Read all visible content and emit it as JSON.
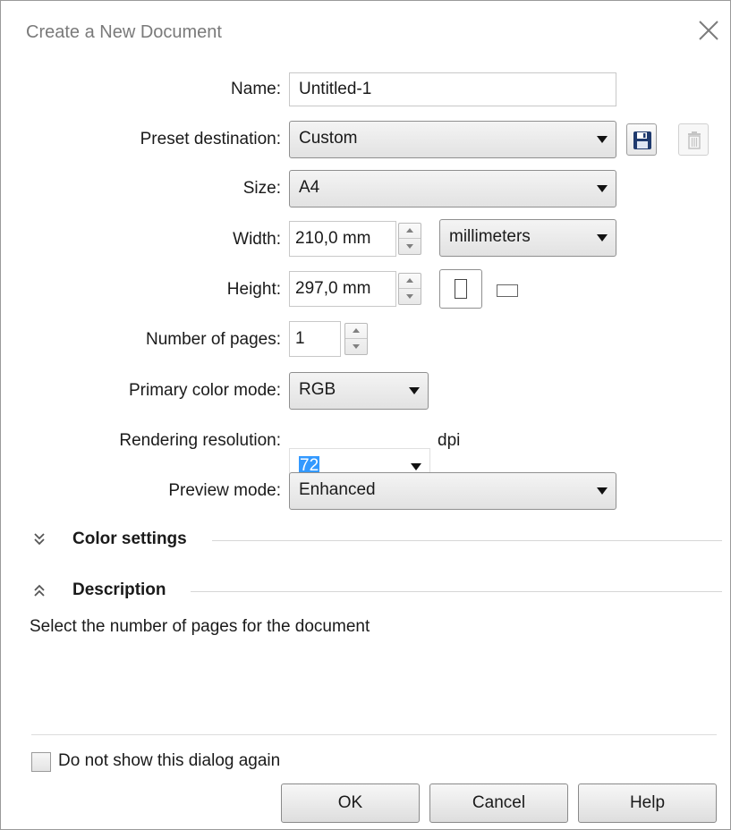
{
  "window": {
    "title": "Create a New Document",
    "close_icon": "close-icon"
  },
  "form": {
    "name": {
      "label": "Name:",
      "value": "Untitled-1"
    },
    "preset_destination": {
      "label": "Preset destination:",
      "value": "Custom",
      "save_icon": "save-icon",
      "delete_icon": "trash-icon"
    },
    "size": {
      "label": "Size:",
      "value": "A4"
    },
    "width": {
      "label": "Width:",
      "value": "210,0 mm",
      "units": "millimeters"
    },
    "height": {
      "label": "Height:",
      "value": "297,0 mm",
      "portrait_icon": "portrait-page-icon",
      "landscape_icon": "landscape-page-icon"
    },
    "pages": {
      "label": "Number of pages:",
      "value": "1"
    },
    "color_mode": {
      "label": "Primary color mode:",
      "value": "RGB"
    },
    "resolution": {
      "label": "Rendering resolution:",
      "value": "72",
      "unit": "dpi"
    },
    "preview_mode": {
      "label": "Preview mode:",
      "value": "Enhanced"
    }
  },
  "sections": {
    "color_settings": {
      "label": "Color settings",
      "state": "collapsed"
    },
    "description": {
      "label": "Description",
      "state": "expanded"
    }
  },
  "description_text": "Select the number of pages for the document",
  "footer": {
    "checkbox_label": "Do not show this dialog again",
    "checkbox_checked": false,
    "ok_label": "OK",
    "cancel_label": "Cancel",
    "help_label": "Help"
  },
  "colors": {
    "selection": "#3399ff",
    "title_text": "#7a7a7a",
    "border": "#8f8f8f"
  }
}
